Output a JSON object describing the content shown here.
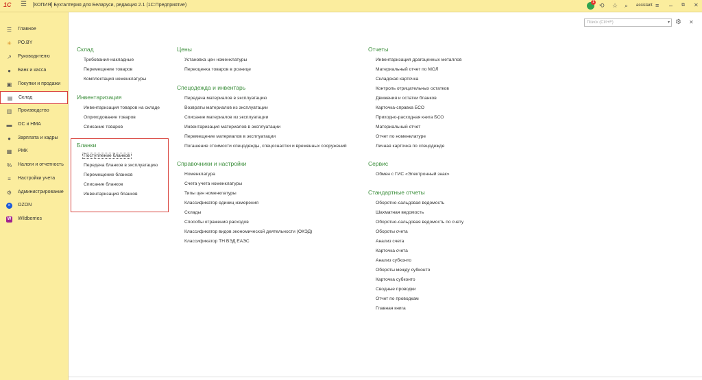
{
  "window": {
    "logo": "1С",
    "title": "[КОПИЯ] Бухгалтерия для Беларуси, редакция 2.1  (1С:Предприятие)",
    "notifications_count": "1",
    "user": "assistant"
  },
  "sidebar": {
    "items": [
      {
        "label": "Главное",
        "icon": "menu-icon"
      },
      {
        "label": "PO.BY",
        "icon": "sun-icon"
      },
      {
        "label": "Руководителю",
        "icon": "trend-icon"
      },
      {
        "label": "Банк и касса",
        "icon": "coin-icon"
      },
      {
        "label": "Покупки и продажи",
        "icon": "cart-icon"
      },
      {
        "label": "Склад",
        "icon": "warehouse-icon"
      },
      {
        "label": "Производство",
        "icon": "factory-icon"
      },
      {
        "label": "ОС и НМА",
        "icon": "truck-icon"
      },
      {
        "label": "Зарплата и кадры",
        "icon": "person-icon"
      },
      {
        "label": "РМК",
        "icon": "register-icon"
      },
      {
        "label": "Налоги и отчетность",
        "icon": "percent-icon"
      },
      {
        "label": "Настройки учета",
        "icon": "sliders-icon"
      },
      {
        "label": "Администрирование",
        "icon": "gear-icon"
      },
      {
        "label": "OZON",
        "icon": "ozon-icon"
      },
      {
        "label": "Wildberries",
        "icon": "wildberries-icon"
      }
    ],
    "active_index": 5
  },
  "search": {
    "placeholder": "Поиск (Ctrl+F)"
  },
  "sections": {
    "sklad": {
      "title": "Склад",
      "links": [
        "Требования-накладные",
        "Перемещение товаров",
        "Комплектация номенклатуры"
      ]
    },
    "inventarizaciya": {
      "title": "Инвентаризация",
      "links": [
        "Инвентаризация товаров на складе",
        "Оприходование товаров",
        "Списание товаров"
      ]
    },
    "blanki": {
      "title": "Бланки",
      "links": [
        "Поступление бланков",
        "Передача бланков в эксплуатацию",
        "Перемещение бланков",
        "Списание бланков",
        "Инвентаризация бланков"
      ]
    },
    "ceny": {
      "title": "Цены",
      "links": [
        "Установка цен номенклатуры",
        "Переоценка товаров в рознице"
      ]
    },
    "specodezhda": {
      "title": "Спецодежда и инвентарь",
      "links": [
        "Передача материалов в эксплуатацию",
        "Возвраты материалов из эксплуатации",
        "Списание материалов из эксплуатации",
        "Инвентаризация материалов в эксплуатации",
        "Перемещение материалов в эксплуатации",
        "Погашение стоимости спецодежды, спецоснастки и временных сооружений"
      ]
    },
    "spravochniki": {
      "title": "Справочники и настройки",
      "links": [
        "Номенклатура",
        "Счета учета номенклатуры",
        "Типы цен номенклатуры",
        "Классификатор единиц измерения",
        "Склады",
        "Способы отражения расходов",
        "Классификатор видов экономической деятельности (ОКЭД)",
        "Классификатор ТН ВЭД ЕАЭС"
      ]
    },
    "otchety": {
      "title": "Отчеты",
      "links": [
        "Инвентаризация драгоценных металлов",
        "Материальный отчет по МОЛ",
        "Складская карточка",
        "Контроль отрицательных остатков",
        "Движения и остатки бланков",
        "Карточка-справка БСО",
        "Приходно-расходная книга БСО",
        "Материальный отчет",
        "Отчет по номенклатуре",
        "Личная карточка по спецодежде"
      ]
    },
    "servis": {
      "title": "Сервис",
      "links": [
        "Обмен с ГИС «Электронный знак»"
      ]
    },
    "standartnye": {
      "title": "Стандартные отчеты",
      "links": [
        "Оборотно-сальдовая ведомость",
        "Шахматная ведомость",
        "Оборотно-сальдовая ведомость по счету",
        "Обороты счета",
        "Анализ счета",
        "Карточка счета",
        "Анализ субконто",
        "Обороты между субконто",
        "Карточка субконто",
        "Сводные проводки",
        "Отчет по проводкам",
        "Главная книга"
      ]
    }
  }
}
